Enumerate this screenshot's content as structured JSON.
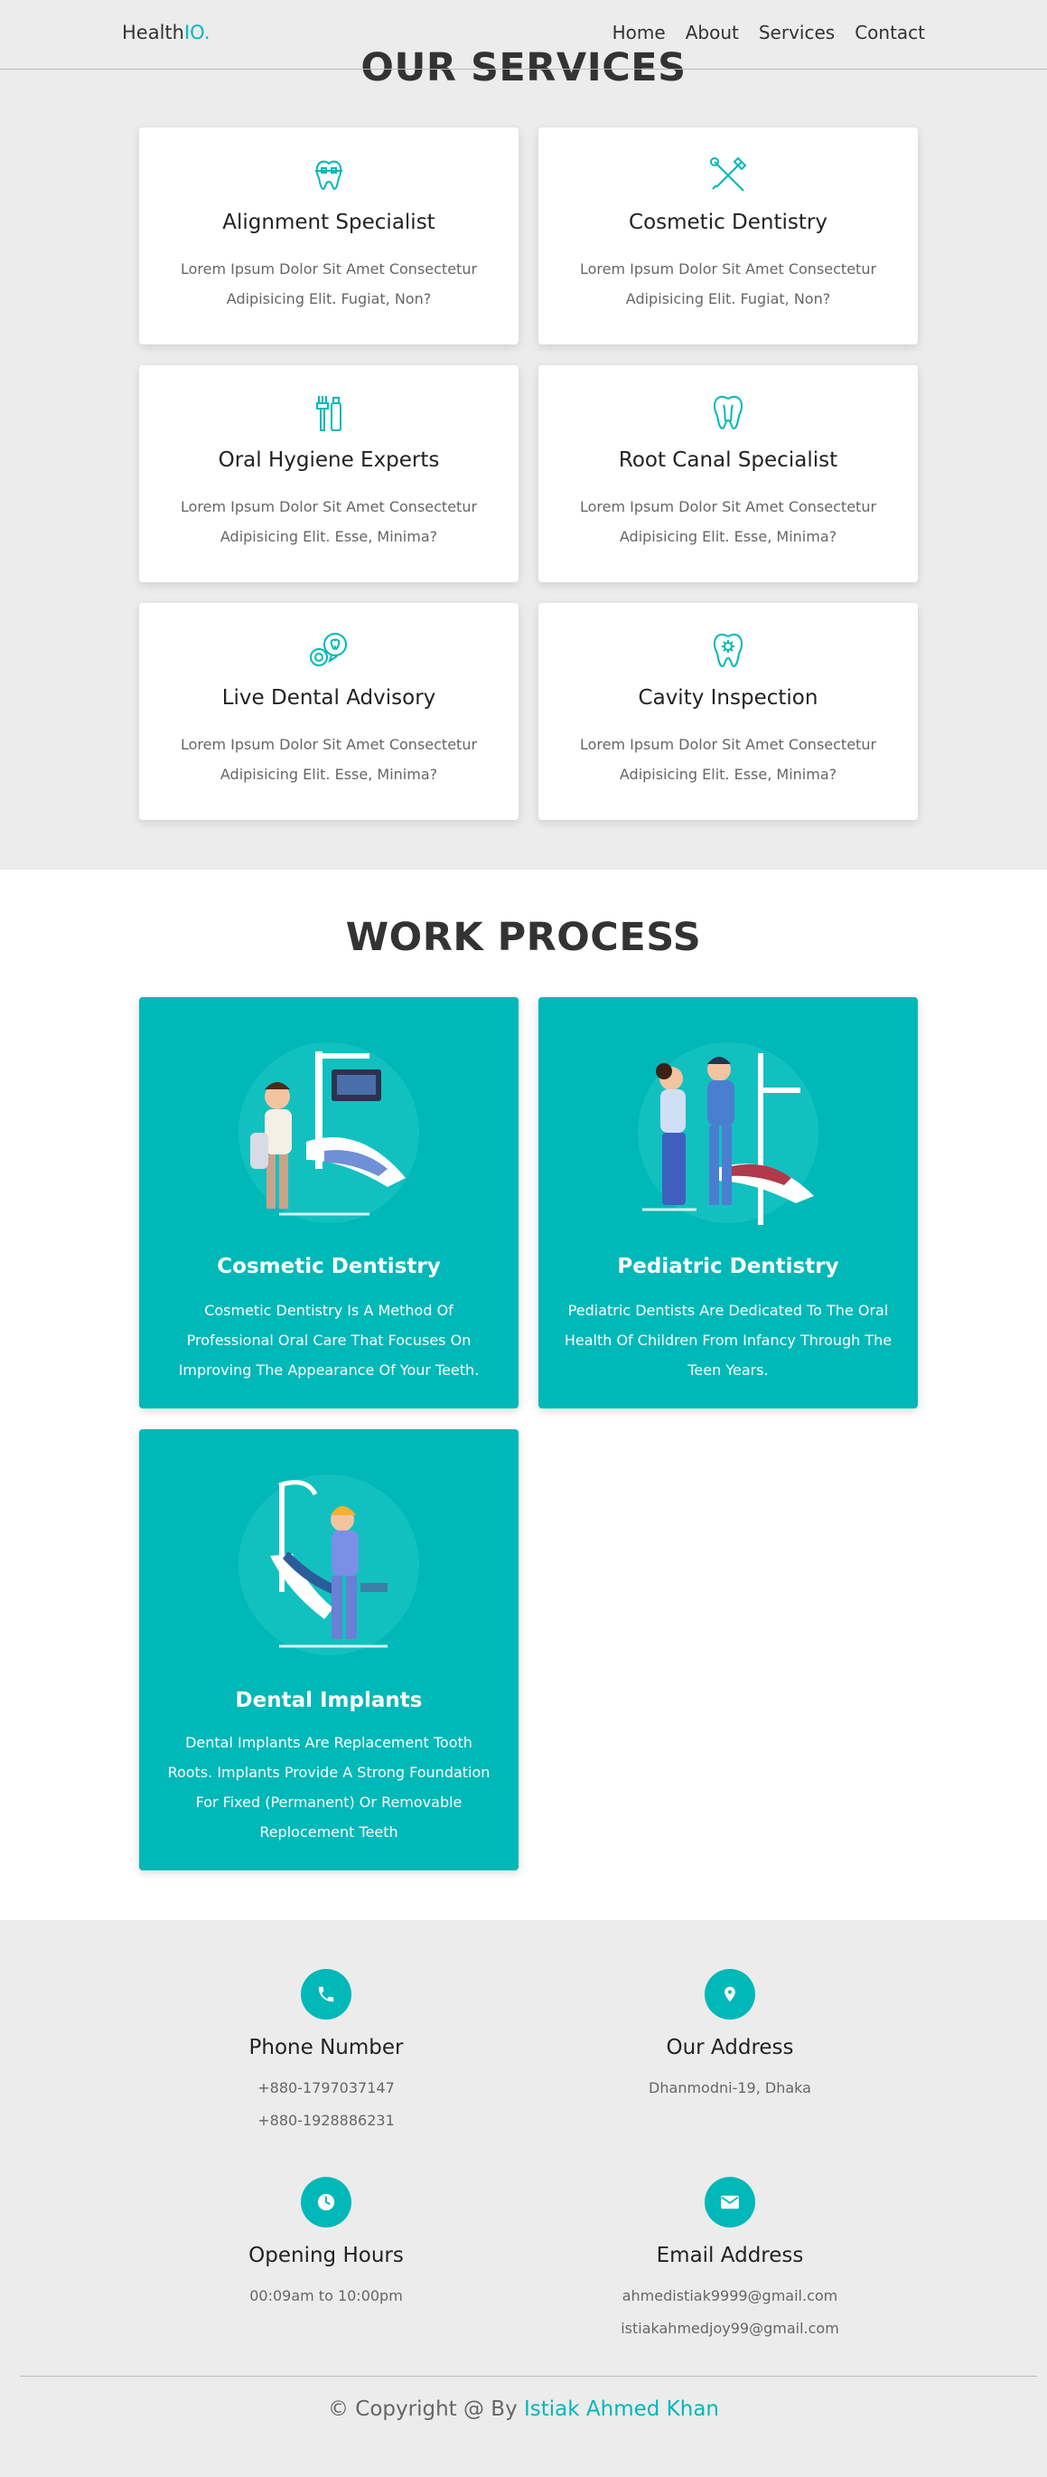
{
  "header": {
    "logo_main": "Health",
    "logo_accent": "IO.",
    "nav": [
      "Home",
      "About",
      "Services",
      "Contact"
    ]
  },
  "services": {
    "title": "OUR SERVICES",
    "cards": [
      {
        "icon": "tooth-braces-icon",
        "title": "Alignment Specialist",
        "text": "Lorem Ipsum Dolor Sit Amet Consectetur Adipisicing Elit. Fugiat, Non?"
      },
      {
        "icon": "dental-tools-icon",
        "title": "Cosmetic Dentistry",
        "text": "Lorem Ipsum Dolor Sit Amet Consectetur Adipisicing Elit. Fugiat, Non?"
      },
      {
        "icon": "toothbrush-paste-icon",
        "title": "Oral Hygiene Experts",
        "text": "Lorem Ipsum Dolor Sit Amet Consectetur Adipisicing Elit. Esse, Minima?"
      },
      {
        "icon": "root-canal-tooth-icon",
        "title": "Root Canal Specialist",
        "text": "Lorem Ipsum Dolor Sit Amet Consectetur Adipisicing Elit. Esse, Minima?"
      },
      {
        "icon": "chat-bubbles-tooth-icon",
        "title": "Live Dental Advisory",
        "text": "Lorem Ipsum Dolor Sit Amet Consectetur Adipisicing Elit. Esse, Minima?"
      },
      {
        "icon": "tooth-gear-icon",
        "title": "Cavity Inspection",
        "text": "Lorem Ipsum Dolor Sit Amet Consectetur Adipisicing Elit. Esse, Minima?"
      }
    ]
  },
  "work": {
    "title": "WORK PROCESS",
    "cards": [
      {
        "title": "Cosmetic Dentistry",
        "text": "Cosmetic Dentistry Is A Method Of Professional Oral Care That Focuses On Improving The Appearance Of Your Teeth."
      },
      {
        "title": "Pediatric Dentistry",
        "text": "Pediatric Dentists Are Dedicated To The Oral Health Of Children From Infancy Through The Teen Years."
      },
      {
        "title": "Dental Implants",
        "text": "Dental Implants Are Replacement Tooth Roots. Implants Provide A Strong Foundation For Fixed (Permanent) Or Removable Replocement Teeth"
      }
    ]
  },
  "contact": {
    "items": [
      {
        "icon": "phone-icon",
        "title": "Phone Number",
        "lines": [
          "+880-1797037147",
          "+880-1928886231"
        ]
      },
      {
        "icon": "map-pin-icon",
        "title": "Our Address",
        "lines": [
          "Dhanmodni-19, Dhaka"
        ]
      },
      {
        "icon": "clock-icon",
        "title": "Opening Hours",
        "lines": [
          "00:09am to 10:00pm"
        ]
      },
      {
        "icon": "envelope-icon",
        "title": "Email Address",
        "lines": [
          "ahmedistiak9999@gmail.com",
          "istiakahmedjoy99@gmail.com"
        ]
      }
    ]
  },
  "footer": {
    "copyright_prefix": "© Copyright @ By",
    "author": "Istiak Ahmed Khan"
  },
  "colors": {
    "accent": "#00b8b8",
    "section_gray": "#ececec",
    "text_dark": "#333333"
  }
}
